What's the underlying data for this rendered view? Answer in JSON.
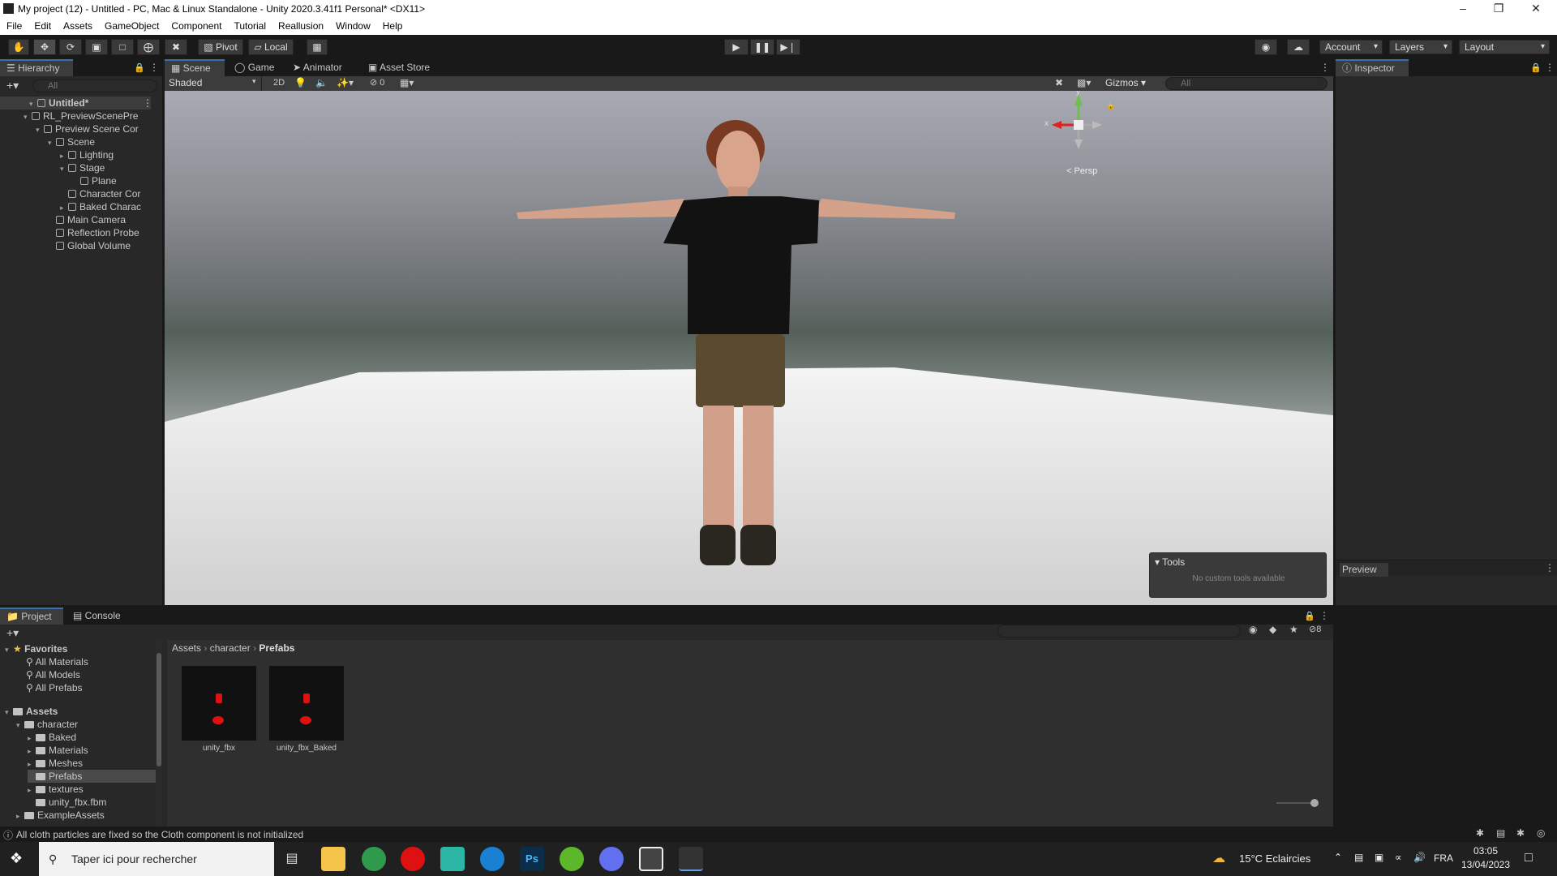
{
  "window": {
    "title": "My project (12) - Untitled - PC, Mac & Linux Standalone - Unity 2020.3.41f1 Personal* <DX11>",
    "controls": [
      "–",
      "❐",
      "✕"
    ]
  },
  "menu": [
    "File",
    "Edit",
    "Assets",
    "GameObject",
    "Component",
    "Tutorial",
    "Reallusion",
    "Window",
    "Help"
  ],
  "toolbar": {
    "pivot_label": "Pivot",
    "local_label": "Local",
    "account_label": "Account",
    "layers_label": "Layers",
    "layout_label": "Layout"
  },
  "hierarchy": {
    "tab_label": "Hierarchy",
    "search_placeholder": "All",
    "rows": [
      {
        "label": "Untitled*",
        "level": 0,
        "expanded": true,
        "bold": true
      },
      {
        "label": "RL_PreviewScenePre",
        "level": 1,
        "expanded": true
      },
      {
        "label": "Preview Scene Cor",
        "level": 2,
        "expanded": true
      },
      {
        "label": "Scene",
        "level": 3,
        "expanded": true
      },
      {
        "label": "Lighting",
        "level": 4,
        "expanded": false
      },
      {
        "label": "Stage",
        "level": 4,
        "expanded": true
      },
      {
        "label": "Plane",
        "level": 5,
        "expanded": null
      },
      {
        "label": "Character Cor",
        "level": 4,
        "expanded": null
      },
      {
        "label": "Baked Charac",
        "level": 4,
        "expanded": false
      },
      {
        "label": "Main Camera",
        "level": 3,
        "expanded": null
      },
      {
        "label": "Reflection Probe",
        "level": 3,
        "expanded": null
      },
      {
        "label": "Global Volume",
        "level": 3,
        "expanded": null
      }
    ]
  },
  "scene_tabs": [
    "Scene",
    "Game",
    "Animator",
    "Asset Store"
  ],
  "scene_toolbar": {
    "shading_mode": "Shaded",
    "mode_2d": "2D",
    "hidden_count": "0",
    "gizmos_label": "Gizmos",
    "search_placeholder": "All"
  },
  "scene_view": {
    "gizmo_y": "y",
    "gizmo_x": "x",
    "projection_label": "< Persp",
    "tools_overlay_title": "Tools",
    "tools_overlay_text": "No custom tools available"
  },
  "inspector": {
    "tab_label": "Inspector",
    "preview_label": "Preview"
  },
  "project": {
    "tabs": [
      "Project",
      "Console"
    ],
    "favorites_label": "Favorites",
    "favorites": [
      "All Materials",
      "All Models",
      "All Prefabs"
    ],
    "assets_label": "Assets",
    "tree": [
      {
        "label": "character",
        "level": 1,
        "expanded": true
      },
      {
        "label": "Baked",
        "level": 2,
        "expanded": false
      },
      {
        "label": "Materials",
        "level": 2,
        "expanded": false
      },
      {
        "label": "Meshes",
        "level": 2,
        "expanded": false
      },
      {
        "label": "Prefabs",
        "level": 2,
        "expanded": null,
        "selected": true
      },
      {
        "label": "textures",
        "level": 2,
        "expanded": false
      },
      {
        "label": "unity_fbx.fbm",
        "level": 2,
        "expanded": null
      },
      {
        "label": "ExampleAssets",
        "level": 1,
        "expanded": false
      }
    ],
    "breadcrumb": [
      "Assets",
      "character",
      "Prefabs"
    ],
    "hidden_count": "8",
    "items": [
      "unity_fbx",
      "unity_fbx_Baked"
    ]
  },
  "status": {
    "message": "All cloth particles are fixed so the Cloth component is not initialized"
  },
  "taskbar": {
    "search_placeholder": "Taper ici pour rechercher",
    "weather": "15°C  Eclaircies",
    "language": "FRA",
    "time": "03:05",
    "date": "13/04/2023"
  },
  "colors": {
    "accent": "#3a72b0",
    "panel_bg": "#282828",
    "dark_bg": "#191919",
    "error_red": "#e01010"
  }
}
